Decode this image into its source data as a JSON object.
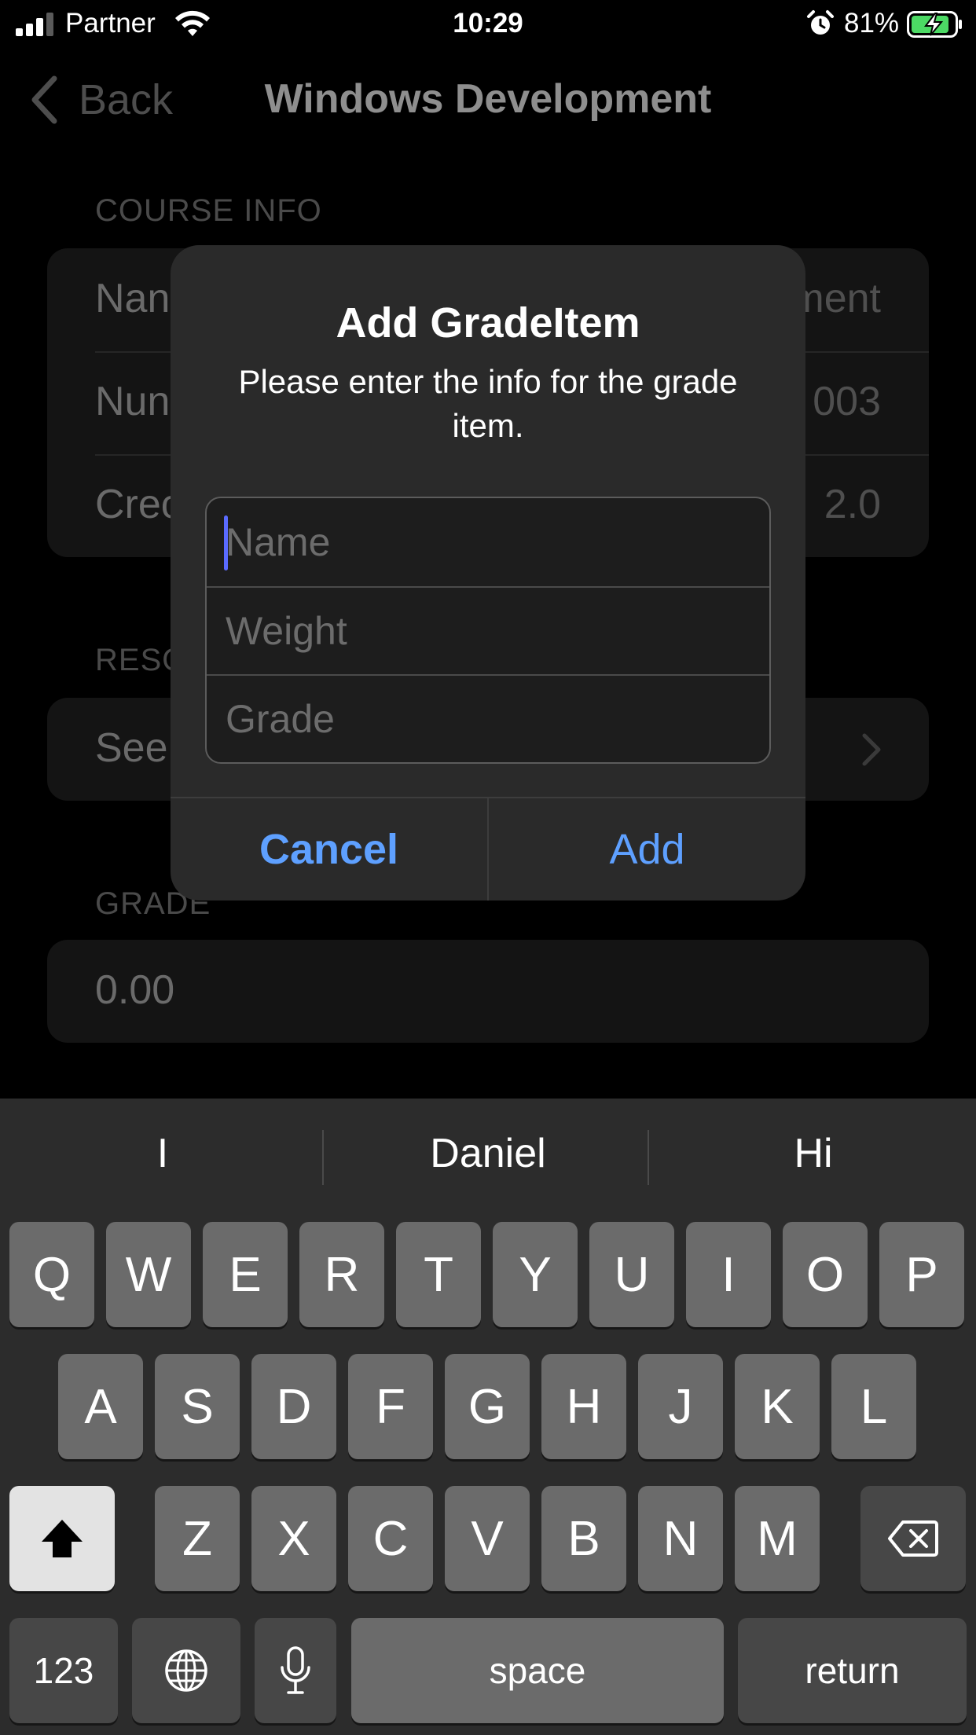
{
  "status_bar": {
    "carrier": "Partner",
    "time": "10:29",
    "battery_percent": "81%",
    "icons": [
      "signal-icon",
      "wifi-icon",
      "alarm-icon",
      "battery-charging-icon"
    ]
  },
  "nav": {
    "back_label": "Back",
    "title": "Windows Development"
  },
  "sections": {
    "course_info": {
      "header": "COURSE INFO",
      "rows": [
        {
          "label": "Nan",
          "value": "ment"
        },
        {
          "label": "Nun",
          "value": "003"
        },
        {
          "label": "Crec",
          "value": "2.0"
        }
      ]
    },
    "resources": {
      "header": "RESO",
      "rows": [
        {
          "label": "See"
        }
      ]
    },
    "grade": {
      "header": "GRADE",
      "value": "0.00"
    }
  },
  "alert": {
    "title": "Add GradeItem",
    "message": "Please enter the info for the grade item.",
    "fields": [
      {
        "placeholder": "Name",
        "value": ""
      },
      {
        "placeholder": "Weight",
        "value": ""
      },
      {
        "placeholder": "Grade",
        "value": ""
      }
    ],
    "cancel_label": "Cancel",
    "add_label": "Add"
  },
  "keyboard": {
    "suggestions": [
      "I",
      "Daniel",
      "Hi"
    ],
    "row1": [
      "Q",
      "W",
      "E",
      "R",
      "T",
      "Y",
      "U",
      "I",
      "O",
      "P"
    ],
    "row2": [
      "A",
      "S",
      "D",
      "F",
      "G",
      "H",
      "J",
      "K",
      "L"
    ],
    "row3": [
      "Z",
      "X",
      "C",
      "V",
      "B",
      "N",
      "M"
    ],
    "numbers_label": "123",
    "space_label": "space",
    "return_label": "return",
    "icons": [
      "shift-icon",
      "backspace-icon",
      "globe-icon",
      "microphone-icon"
    ]
  },
  "colors": {
    "accent": "#5EA0FF",
    "caret": "#5A6BFF",
    "alert_bg": "#2A2A2A",
    "keyboard_bg": "#2C2C2C"
  }
}
